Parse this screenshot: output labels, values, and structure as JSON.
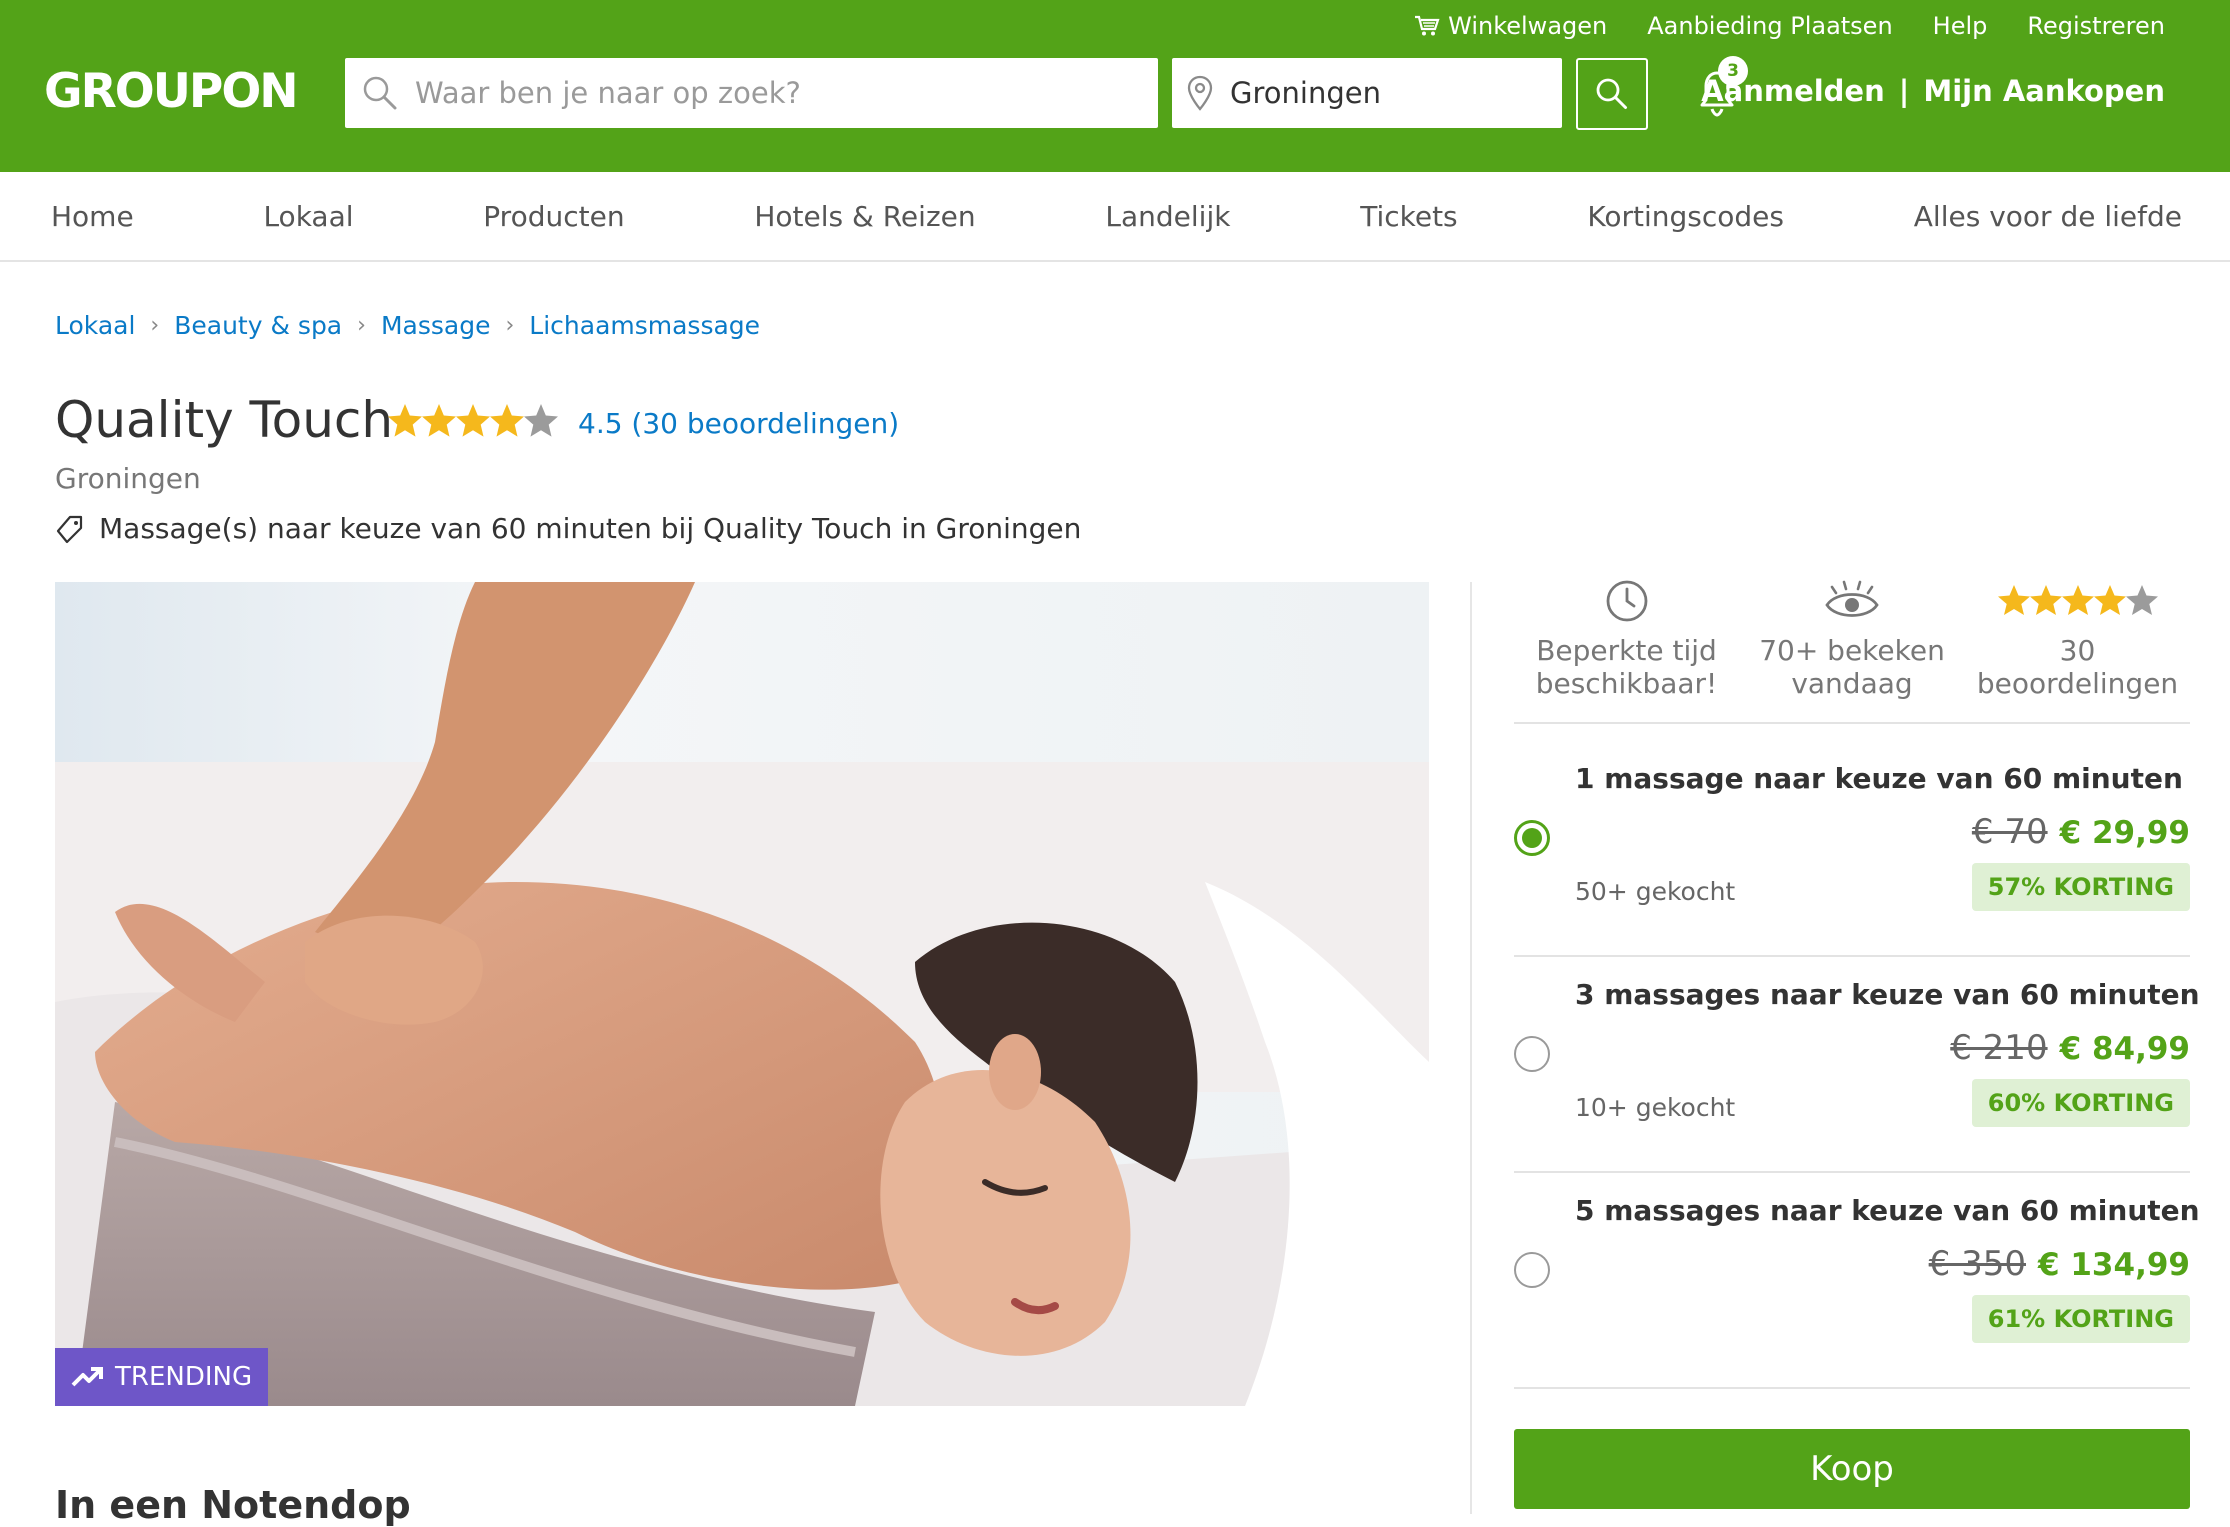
{
  "header": {
    "logo": "GROUPON",
    "top_links": [
      "Winkelwagen",
      "Aanbieding Plaatsen",
      "Help",
      "Registreren"
    ],
    "search_placeholder": "Waar ben je naar op zoek?",
    "location_value": "Groningen",
    "notification_count": "3",
    "login_label": "Aanmelden",
    "separator": "|",
    "purchases_label": "Mijn Aankopen",
    "brand_color": "#53a318"
  },
  "nav": {
    "items": [
      "Home",
      "Lokaal",
      "Producten",
      "Hotels & Reizen",
      "Landelijk",
      "Tickets",
      "Kortingscodes",
      "Alles voor de liefde"
    ]
  },
  "breadcrumb": [
    "Lokaal",
    "Beauty & spa",
    "Massage",
    "Lichaamsmassage"
  ],
  "deal": {
    "title": "Quality Touch",
    "rating": 4.5,
    "rating_text": "4.5 (30 beoordelingen)",
    "city": "Groningen",
    "tagline": "Massage(s) naar keuze van 60 minuten bij Quality Touch in Groningen",
    "image_badge": "TRENDING",
    "section_heading": "In een Notendop"
  },
  "features": [
    {
      "icon": "clock-icon",
      "line1": "Beperkte tijd",
      "line2": "beschikbaar!"
    },
    {
      "icon": "eye-icon",
      "line1": "70+ bekeken",
      "line2": "vandaag"
    },
    {
      "icon": "star-rating-icon",
      "line1": "30",
      "line2": "beoordelingen"
    }
  ],
  "options": [
    {
      "title": "1 massage naar keuze van 60 minuten",
      "old_price": "€ 70",
      "new_price": "€ 29,99",
      "sold": "50+ gekocht",
      "discount": "57% KORTING",
      "selected": true
    },
    {
      "title": "3 massages naar keuze van 60 minuten",
      "old_price": "€ 210",
      "new_price": "€ 84,99",
      "sold": "10+ gekocht",
      "discount": "60% KORTING",
      "selected": false
    },
    {
      "title": "5 massages naar keuze van 60 minuten",
      "old_price": "€ 350",
      "new_price": "€ 134,99",
      "sold": "",
      "discount": "61% KORTING",
      "selected": false
    }
  ],
  "buy_label": "Koop",
  "colors": {
    "link": "#0a7ac7",
    "star": "#f5b81c",
    "trending": "#6e56c8",
    "discount_bg": "#dff0d4"
  }
}
